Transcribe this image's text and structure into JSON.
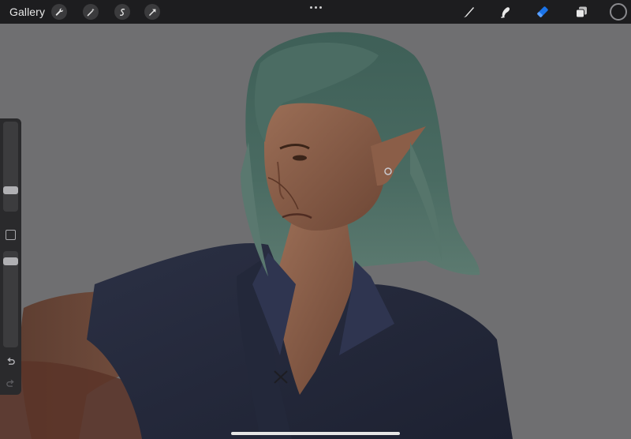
{
  "toolbar": {
    "gallery_label": "Gallery",
    "left_tools": [
      "wrench-icon",
      "magic-wand-icon",
      "selection-icon",
      "transform-icon"
    ],
    "more_menu": "more-dots-icon",
    "right_tools": [
      "brush-icon",
      "smudge-icon",
      "eraser-icon",
      "layers-icon",
      "color-picker"
    ],
    "active_tool": "eraser",
    "active_color": "#1a1a1c",
    "accent": "#1a73e8"
  },
  "sidebar": {
    "brush_size_level": 0.28,
    "opacity_level": 0.92,
    "modify_button": "square-icon",
    "undo": "undo-icon",
    "redo": "redo-icon"
  },
  "canvas": {
    "background": "#6f6f71"
  }
}
